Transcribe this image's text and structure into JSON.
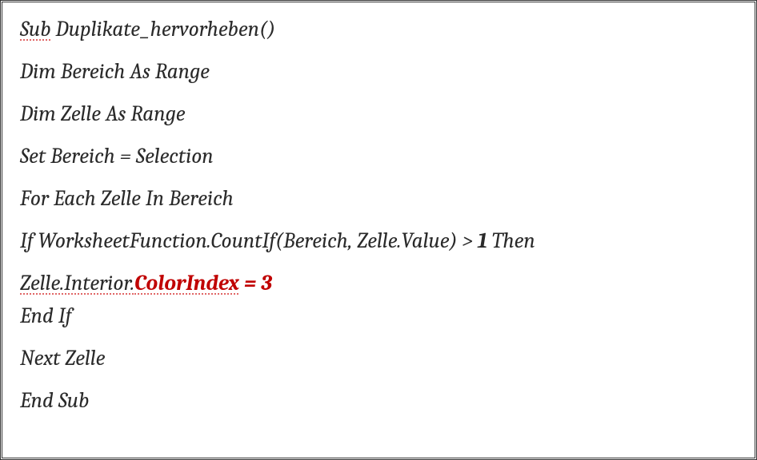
{
  "code": {
    "lines": [
      {
        "segments": [
          {
            "text": "Sub",
            "classes": "dotted-under"
          },
          {
            "text": " Duplikate_hervorheben()",
            "classes": ""
          }
        ]
      },
      {
        "segments": [
          {
            "text": "Dim Bereich As Range",
            "classes": ""
          }
        ]
      },
      {
        "segments": [
          {
            "text": "Dim Zelle As Range",
            "classes": ""
          }
        ]
      },
      {
        "segments": [
          {
            "text": "Set Bereich = Selection",
            "classes": ""
          }
        ]
      },
      {
        "segments": [
          {
            "text": "For Each Zelle In Bereich",
            "classes": ""
          }
        ]
      },
      {
        "segments": [
          {
            "text": "If WorksheetFunction.CountIf(Bereich, Zelle.Value) > ",
            "classes": ""
          },
          {
            "text": "1",
            "classes": "bold"
          },
          {
            "text": " Then",
            "classes": ""
          }
        ]
      },
      {
        "tight": true,
        "segments": [
          {
            "text": "Zelle.Interior.",
            "classes": "dotted-under"
          },
          {
            "text": "ColorIndex",
            "classes": "red dotted-under"
          },
          {
            "text": " = ",
            "classes": "red"
          },
          {
            "text": "3",
            "classes": "red bold"
          }
        ]
      },
      {
        "segments": [
          {
            "text": "End If",
            "classes": ""
          }
        ]
      },
      {
        "segments": [
          {
            "text": "Next Zelle",
            "classes": ""
          }
        ]
      },
      {
        "segments": [
          {
            "text": "End Sub",
            "classes": ""
          }
        ]
      }
    ]
  }
}
